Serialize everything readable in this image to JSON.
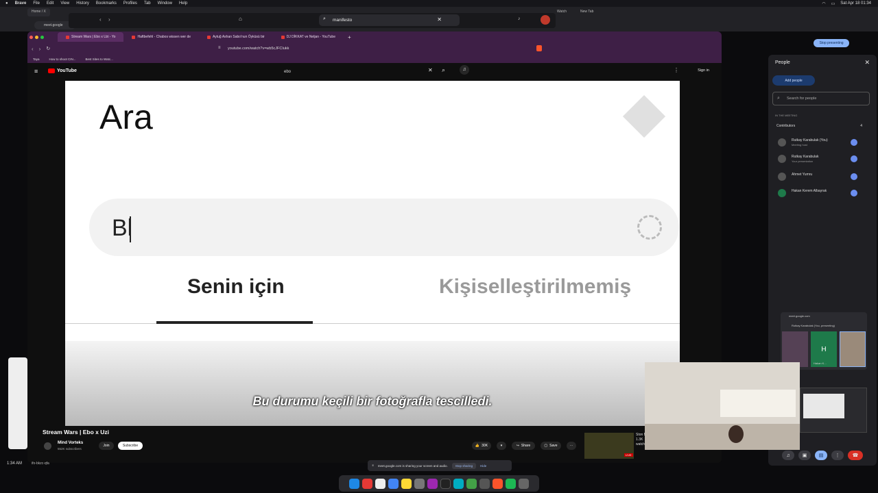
{
  "menubar": {
    "app": "Brave",
    "items": [
      "File",
      "Edit",
      "View",
      "History",
      "Bookmarks",
      "Profiles",
      "Tab",
      "Window",
      "Help"
    ],
    "clock": "Sat Apr 18 01:34"
  },
  "background_window": {
    "tabs": [
      "Home / X",
      "Watch",
      "New Tab"
    ],
    "address": "meet.google"
  },
  "top_search": {
    "query": "manifesto"
  },
  "brave": {
    "tabs": [
      {
        "label": "Stream Wars | Ebo x Uzi - Yo",
        "active": true
      },
      {
        "label": "Haftbefehl - Chabos wissen wer de",
        "active": false
      },
      {
        "label": "Aytuğ Ashan Sabo'nun Öyküsü bir",
        "active": false
      },
      {
        "label": "DJ DİKKAT ve Neljan - YouTube",
        "active": false
      }
    ],
    "url": "youtube.com/watch?v=wb5cJFCIukk",
    "bookmarks": [
      "Taya",
      "How to shoot CIN...",
      "Best Sites to Watc..."
    ]
  },
  "youtube": {
    "logo_text": "YouTube",
    "search_value": "ebo",
    "signin_label": "Sign in",
    "video": {
      "heading": "Ara",
      "search_text": "Bl",
      "tab_selected": "Senin için",
      "tab_other": "Kişiselleştirilmemiş",
      "subtitle": "Bu durumu keçili bir fotoğrafla tescilledi."
    },
    "title": "Stream Wars | Ebo x Uzi",
    "channel": {
      "name": "Mind Vorteks",
      "subscribers": "552K subscribers",
      "join_label": "Join",
      "subscribe_label": "Subscribe"
    },
    "actions": {
      "likes": "30K",
      "share": "Share",
      "save": "Save"
    },
    "live": {
      "badge": "LIVE",
      "title": "Ston Bad",
      "watching": "1.3K watching"
    }
  },
  "meet": {
    "panel_title": "People",
    "add_people": "Add people",
    "search_placeholder": "Search for people",
    "in_meeting": "IN THE MEETING",
    "contributors_label": "Contributors",
    "contributors_count": "4",
    "people": [
      {
        "name": "Rutkay Karabulak (You)",
        "sub": "Meeting host"
      },
      {
        "name": "Rutkay Karabulak",
        "sub": "Your presentation"
      },
      {
        "name": "Ahmet Yumru",
        "sub": ""
      },
      {
        "name": "Hakan Kerem Albayrak",
        "sub": ""
      }
    ],
    "stop_presenting": "Stop presenting",
    "mini": {
      "host": "meet.google.com",
      "presenting": "Rutkay Karabulak (You, presenting)",
      "tile_letter": "H",
      "tile_name": "Hakan K..."
    },
    "share_bar": {
      "text": "meet.google.com is sharing your screen and audio.",
      "stop": "Stop sharing",
      "hide": "Hide"
    },
    "time": "1:34 AM",
    "code": "ifo-bkzc-qfa"
  },
  "colors": {
    "brave_purple": "#3e1f46",
    "yt_red": "#ff0000",
    "meet_blue": "#8ab4f8",
    "end_call": "#d93025"
  }
}
